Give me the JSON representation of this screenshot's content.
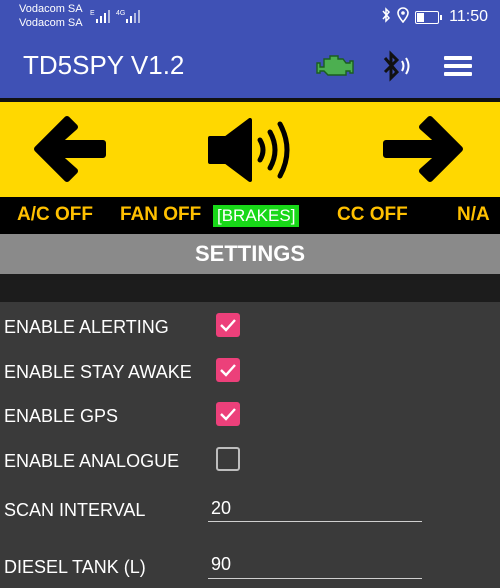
{
  "status_bar": {
    "carrier_1": "Vodacom SA",
    "carrier_2": "Vodacom SA",
    "network_1": "E",
    "network_2": "4G",
    "time": "11:50",
    "icons": [
      "signal-icon",
      "bluetooth-icon",
      "location-icon",
      "battery-icon"
    ],
    "battery_level": 0.3
  },
  "app_bar": {
    "title": "TD5SPY V1.2",
    "icons": [
      "engine-icon",
      "bluetooth-icon",
      "menu-icon"
    ],
    "engine_icon_color": "#4caf50"
  },
  "controls": {
    "icons": [
      "arrow-left-icon",
      "speaker-icon",
      "arrow-right-icon"
    ],
    "background": "#ffd800"
  },
  "status_strip": {
    "ac": "A/C OFF",
    "fan": "FAN OFF",
    "brakes": "[BRAKES]",
    "cc": "CC OFF",
    "na": "N/A",
    "text_color": "#ffc000",
    "brakes_bg": "#18d818"
  },
  "settings": {
    "title": "SETTINGS",
    "toggles": [
      {
        "label": "ENABLE ALERTING",
        "checked": true
      },
      {
        "label": "ENABLE STAY AWAKE",
        "checked": true
      },
      {
        "label": "ENABLE GPS",
        "checked": true
      },
      {
        "label": "ENABLE ANALOGUE",
        "checked": false
      }
    ],
    "fields": [
      {
        "label": "SCAN INTERVAL",
        "value": "20"
      },
      {
        "label": "DIESEL TANK (L)",
        "value": "90"
      }
    ],
    "checkbox_color": "#ec407a"
  }
}
